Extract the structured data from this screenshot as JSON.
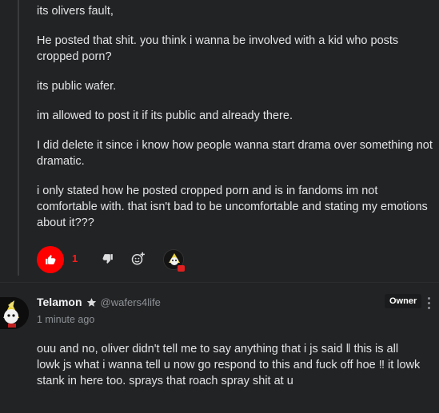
{
  "message": {
    "paragraphs": [
      "its olivers fault,",
      "He posted that shit. you think i wanna be involved with a kid who posts cropped porn?",
      "its public wafer.",
      "im allowed to post it if its public and already there.",
      "I did delete it since i know how people wanna start drama over something not dramatic.",
      "i only stated how he posted cropped porn and is in fandoms im not comfortable with. that isn't bad to be uncomfortable and stating my emotions about it???"
    ],
    "reactions": {
      "like_count": "1",
      "like_color": "#ff0000"
    }
  },
  "reply": {
    "author": "Telamon",
    "handle": "@wafers4life",
    "timestamp": "1 minute ago",
    "badge": "Owner",
    "text": "ouu and no, oliver didn't tell me to say anything that i js said ‖ this is all lowk js what i wanna tell u now go respond to this and fuck off hoe ‼ it lowk stank in here too. sprays that roach spray shit at u"
  },
  "icons": {
    "like": "thumbs-up-icon",
    "dislike": "thumbs-down-icon",
    "add_reaction": "add-reaction-icon",
    "more": "kebab-menu-icon",
    "star": "star-icon"
  }
}
